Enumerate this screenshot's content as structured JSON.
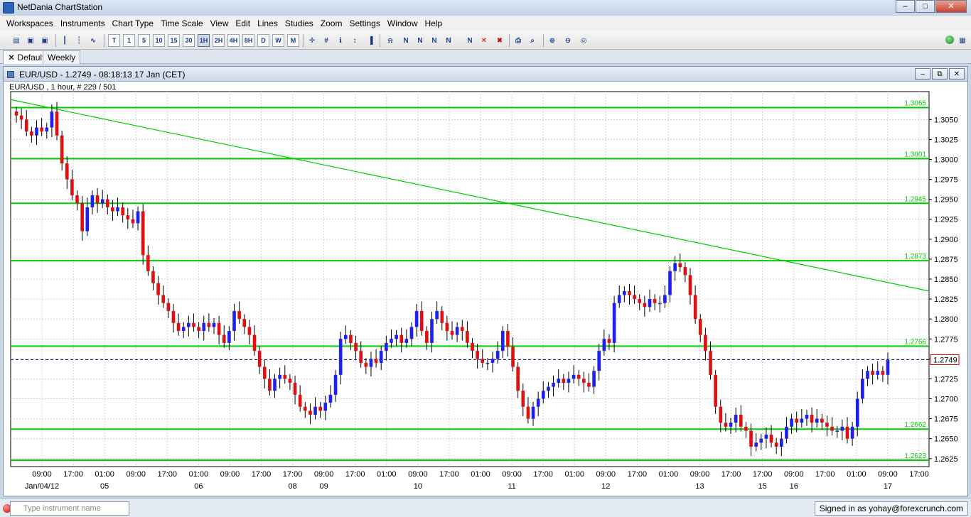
{
  "app": {
    "title": "NetDania ChartStation"
  },
  "menu": [
    "Workspaces",
    "Instruments",
    "Chart Type",
    "Time Scale",
    "View",
    "Edit",
    "Lines",
    "Studies",
    "Zoom",
    "Settings",
    "Window",
    "Help"
  ],
  "toolbar": {
    "timeframes": [
      "T",
      "1",
      "5",
      "10",
      "15",
      "30",
      "1H",
      "2H",
      "4H",
      "8H",
      "D",
      "W",
      "M"
    ],
    "active_timeframe": "1H"
  },
  "tabs": [
    {
      "label": "Default",
      "active": true
    },
    {
      "label": "Weekly",
      "active": false
    }
  ],
  "chart_window": {
    "title": "EUR/USD - 1.2749 - 08:18:13  17 Jan (CET)",
    "info": "EUR/USD , 1 hour, # 229 / 501"
  },
  "status": {
    "search_placeholder": "Type instrument name",
    "signed_in": "Signed in as yohay@forexcrunch.com"
  },
  "colors": {
    "up": "#1f1ff0",
    "down": "#e01010",
    "level": "#00cc00",
    "background": "#ffffff"
  },
  "chart_data": {
    "type": "candlestick",
    "instrument": "EUR/USD",
    "interval": "1 hour",
    "ylim": [
      1.2615,
      1.3085
    ],
    "y_ticks": [
      "1.3050",
      "1.3025",
      "1.3000",
      "1.2975",
      "1.2950",
      "1.2925",
      "1.2900",
      "1.2875",
      "1.2850",
      "1.2825",
      "1.2800",
      "1.2775",
      "1.2750",
      "1.2725",
      "1.2700",
      "1.2675",
      "1.2650",
      "1.2625"
    ],
    "x_ticks": [
      "09:00",
      "17:00",
      "01:00",
      "09:00",
      "17:00",
      "01:00",
      "09:00",
      "17:00",
      "17:00",
      "09:00",
      "17:00",
      "01:00",
      "09:00",
      "17:00",
      "01:00",
      "09:00",
      "17:00",
      "01:00",
      "09:00",
      "17:00",
      "01:00",
      "09:00",
      "17:00",
      "17:00",
      "09:00",
      "17:00",
      "01:00",
      "09:00",
      "17:00"
    ],
    "date_labels": [
      "Jan/04/12",
      "05",
      "06",
      "08",
      "09",
      "10",
      "11",
      "12",
      "13",
      "15",
      "16",
      "17"
    ],
    "levels": [
      "1.3065",
      "1.3001",
      "1.2945",
      "1.2873",
      "1.2766",
      "1.2662",
      "1.2623"
    ],
    "current_price": "1.2749",
    "trendline": {
      "start": 1.3075,
      "end": 1.2835
    },
    "closes": [
      1.3055,
      1.305,
      1.3035,
      1.303,
      1.304,
      1.3035,
      1.304,
      1.306,
      1.303,
      1.2995,
      1.2975,
      1.2955,
      1.2945,
      1.291,
      1.294,
      1.2955,
      1.2945,
      1.295,
      1.294,
      1.2935,
      1.294,
      1.293,
      1.2925,
      1.292,
      1.2935,
      1.288,
      1.286,
      1.2845,
      1.283,
      1.282,
      1.281,
      1.2795,
      1.2785,
      1.279,
      1.2795,
      1.279,
      1.2785,
      1.2795,
      1.279,
      1.2795,
      1.278,
      1.277,
      1.2785,
      1.281,
      1.28,
      1.279,
      1.278,
      1.276,
      1.274,
      1.2725,
      1.271,
      1.2725,
      1.273,
      1.2725,
      1.272,
      1.2705,
      1.269,
      1.2685,
      1.268,
      1.269,
      1.2685,
      1.2695,
      1.2705,
      1.273,
      1.2775,
      1.278,
      1.277,
      1.276,
      1.2745,
      1.274,
      1.275,
      1.2745,
      1.276,
      1.277,
      1.2775,
      1.278,
      1.277,
      1.2775,
      1.279,
      1.281,
      1.2785,
      1.277,
      1.28,
      1.281,
      1.2795,
      1.2785,
      1.278,
      1.279,
      1.2785,
      1.277,
      1.276,
      1.275,
      1.2745,
      1.2745,
      1.275,
      1.276,
      1.2785,
      1.2765,
      1.274,
      1.271,
      1.269,
      1.2675,
      1.269,
      1.27,
      1.271,
      1.2715,
      1.272,
      1.2725,
      1.272,
      1.2725,
      1.273,
      1.2725,
      1.272,
      1.2715,
      1.2735,
      1.276,
      1.2775,
      1.277,
      1.282,
      1.283,
      1.2835,
      1.283,
      1.2825,
      1.282,
      1.2815,
      1.2825,
      1.282,
      1.282,
      1.283,
      1.286,
      1.287,
      1.2865,
      1.2855,
      1.283,
      1.28,
      1.278,
      1.276,
      1.273,
      1.269,
      1.267,
      1.2665,
      1.267,
      1.268,
      1.2665,
      1.266,
      1.264,
      1.2645,
      1.265,
      1.2655,
      1.2645,
      1.264,
      1.265,
      1.2665,
      1.2675,
      1.267,
      1.2675,
      1.268,
      1.267,
      1.2675,
      1.267,
      1.2665,
      1.266,
      1.266,
      1.2665,
      1.265,
      1.2665,
      1.27,
      1.2725,
      1.2735,
      1.273,
      1.2735,
      1.273,
      1.2749
    ]
  }
}
